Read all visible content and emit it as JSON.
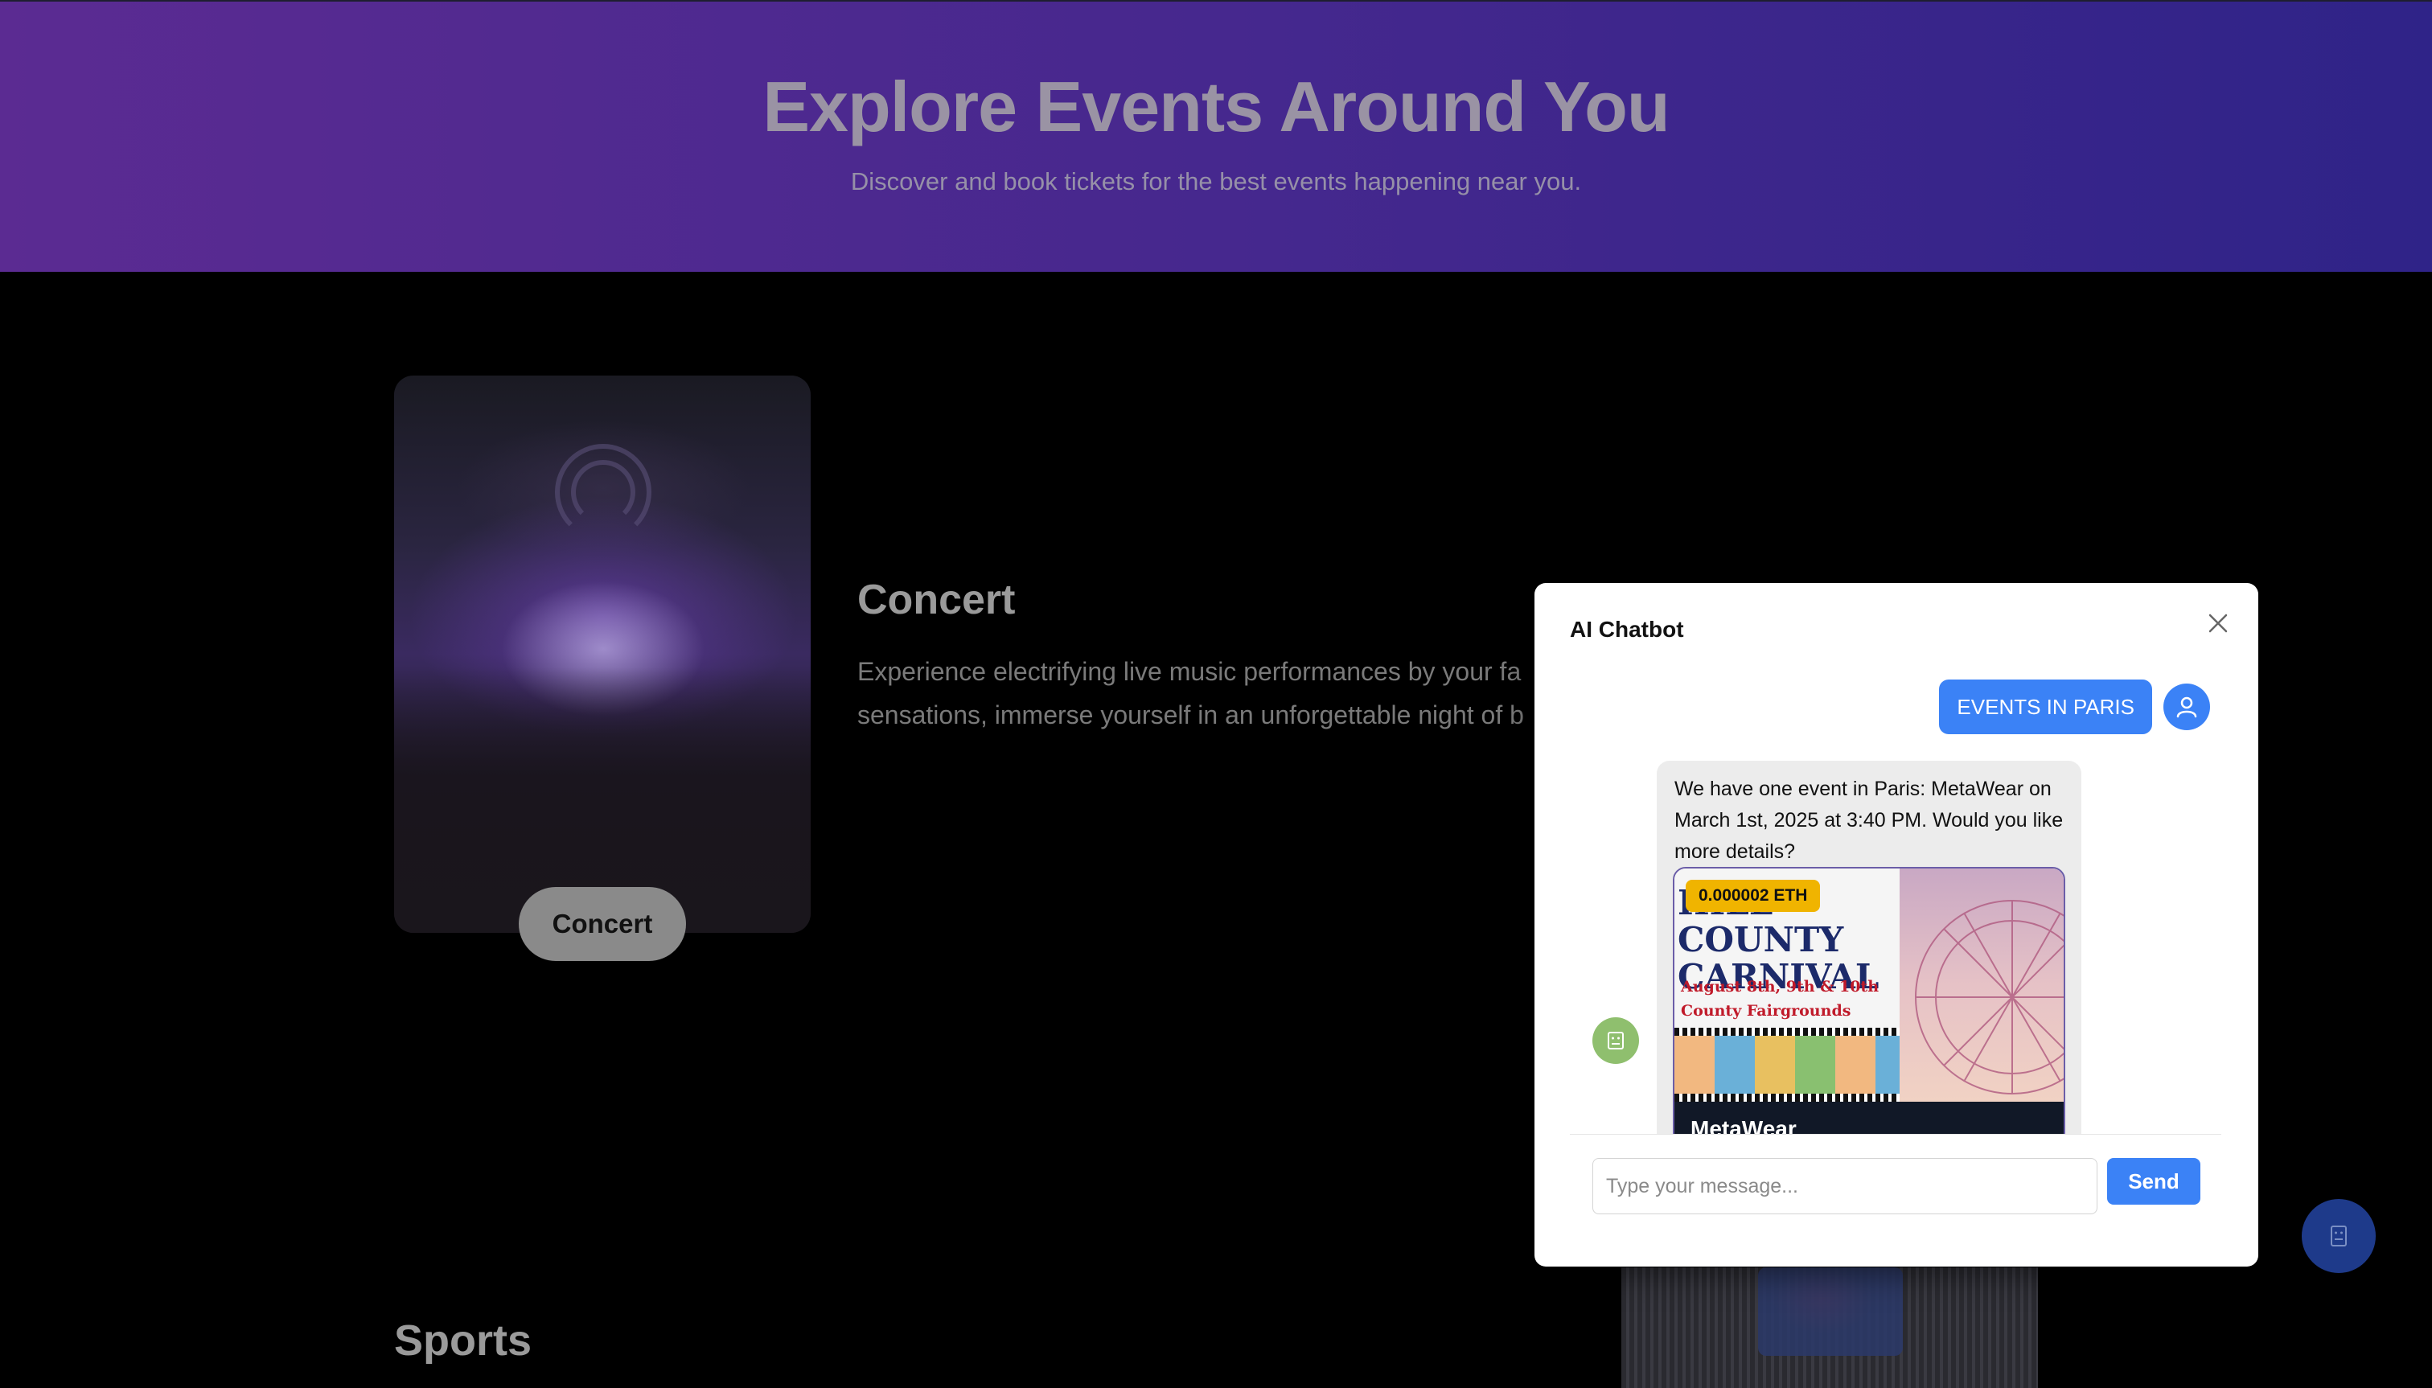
{
  "hero": {
    "title": "Explore Events Around You",
    "subtitle": "Discover and book tickets for the best events happening near you."
  },
  "category": {
    "card_button": "Concert",
    "title": "Concert",
    "description_line1": "Experience electrifying live music performances by your fa",
    "description_line2": "sensations, immerse yourself in an unforgettable night of b"
  },
  "sports": {
    "title": "Sports"
  },
  "chatbot": {
    "title": "AI Chatbot",
    "user_message": "EVENTS IN PARIS",
    "bot_message": "We have one event in Paris: MetaWear on March 1st, 2025 at 3:40 PM. Would you like more details?",
    "event": {
      "price_badge": "0.000002 ETH",
      "poster_title_line1": "HILL COUNTY",
      "poster_title_line2": "CARNIVAL",
      "poster_date": "August 8th, 9th & 10th",
      "poster_location": "County Fairgrounds",
      "name": "MetaWear"
    },
    "input_placeholder": "Type your message...",
    "send_label": "Send"
  },
  "icons": {
    "close": "close-icon",
    "user": "user-icon",
    "bot": "bot-icon",
    "fab": "chatbot-icon"
  },
  "colors": {
    "accent": "#3b82f6",
    "badge": "#f0b400",
    "bot_avatar": "#8fbf6e",
    "fab": "#1e3a8a"
  }
}
